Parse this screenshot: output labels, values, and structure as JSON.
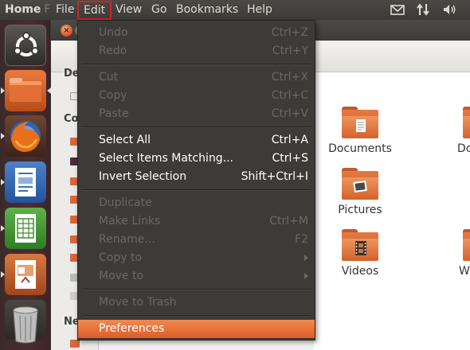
{
  "top_panel": {
    "app_title": "Home",
    "app_title_fade": "F",
    "menus": [
      "File",
      "Edit",
      "View",
      "Go",
      "Bookmarks",
      "Help"
    ],
    "tray_icons": [
      "mail-icon",
      "network-icon",
      "volume-icon"
    ]
  },
  "launcher": {
    "items": [
      "ubuntu-dash-icon",
      "home-folder-icon",
      "firefox-icon",
      "writer-icon",
      "calc-icon",
      "impress-icon",
      "trash-icon"
    ]
  },
  "file_manager": {
    "sidebar_headings": [
      "De",
      "Co",
      "Ne"
    ],
    "folders": [
      {
        "label": "Documents",
        "icon": "documents-folder-icon"
      },
      {
        "label": "Pictures",
        "icon": "pictures-folder-icon"
      },
      {
        "label": "Videos",
        "icon": "videos-folder-icon"
      }
    ],
    "partial_labels": [
      "Dc",
      "W"
    ]
  },
  "edit_menu": {
    "items": [
      {
        "label": "Undo",
        "accel": "Ctrl+Z",
        "enabled": false
      },
      {
        "label": "Redo",
        "accel": "Ctrl+Y",
        "enabled": false
      },
      {
        "label": "Cut",
        "accel": "Ctrl+X",
        "enabled": false
      },
      {
        "label": "Copy",
        "accel": "Ctrl+C",
        "enabled": false
      },
      {
        "label": "Paste",
        "accel": "Ctrl+V",
        "enabled": false
      },
      {
        "label": "Select All",
        "accel": "Ctrl+A",
        "enabled": true
      },
      {
        "label": "Select Items Matching...",
        "accel": "Ctrl+S",
        "enabled": true
      },
      {
        "label": "Invert Selection",
        "accel": "Shift+Ctrl+I",
        "enabled": true
      },
      {
        "label": "Duplicate",
        "accel": "",
        "enabled": false
      },
      {
        "label": "Make Links",
        "accel": "Ctrl+M",
        "enabled": false
      },
      {
        "label": "Rename...",
        "accel": "F2",
        "enabled": false
      },
      {
        "label": "Copy to",
        "accel": "",
        "enabled": false
      },
      {
        "label": "Move to",
        "accel": "",
        "enabled": false
      },
      {
        "label": "Move to Trash",
        "accel": "",
        "enabled": false
      },
      {
        "label": "Preferences",
        "accel": "",
        "enabled": true
      }
    ]
  },
  "colors": {
    "accent": "#dd5c27",
    "highlight_box": "#d2222d",
    "menu_bg": "#3c3b37"
  }
}
